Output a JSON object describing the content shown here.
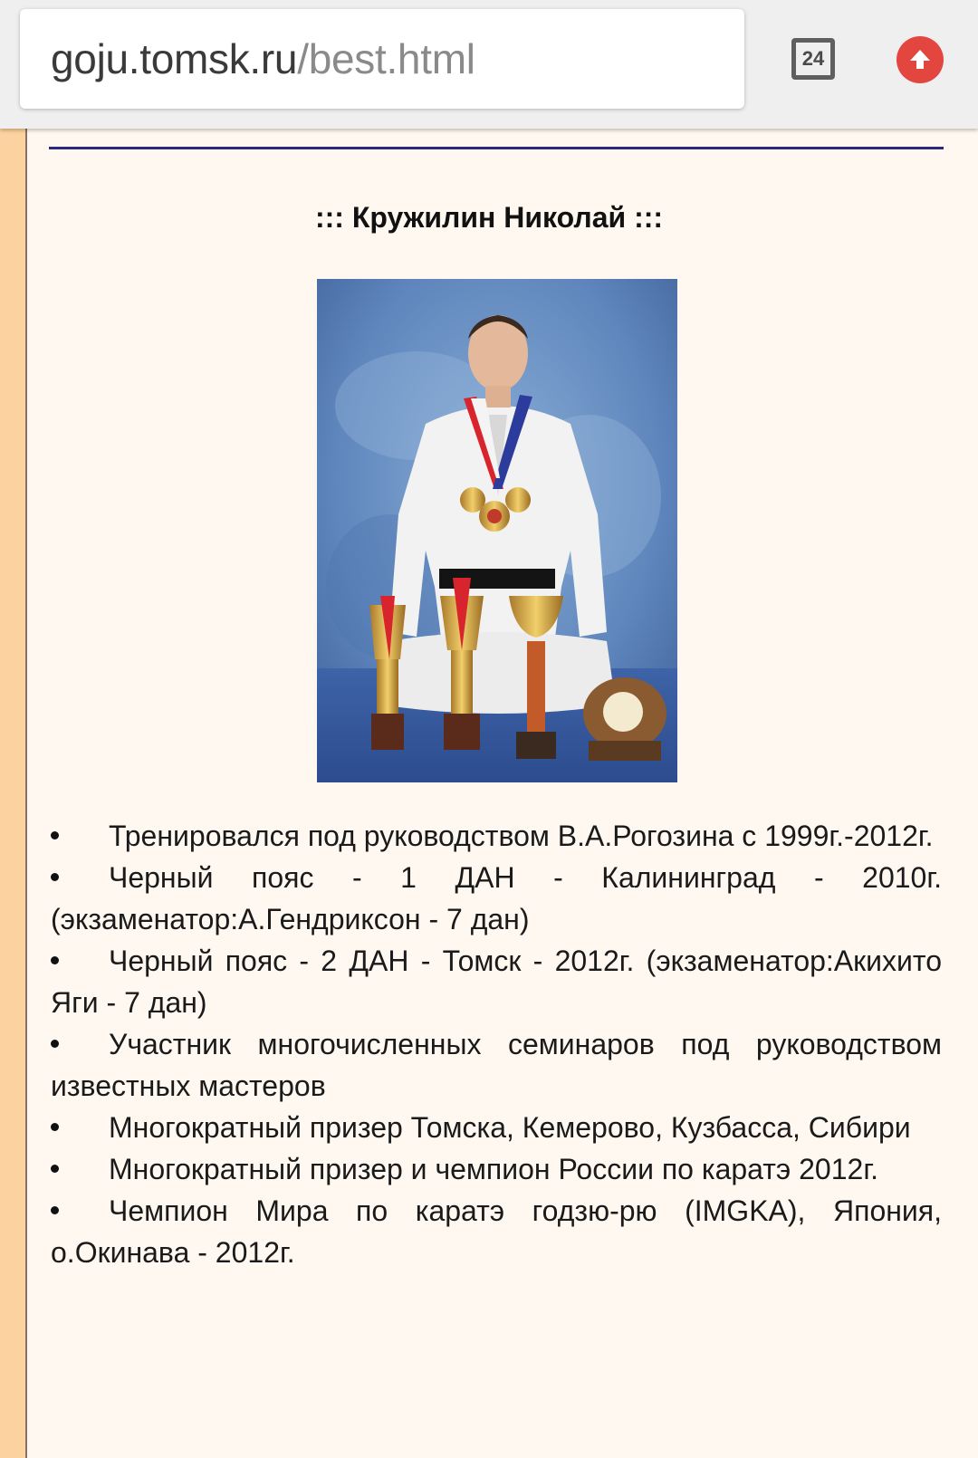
{
  "browser": {
    "url_host": "goju.tomsk.ru",
    "url_path": "/best.html",
    "tab_count": "24",
    "update_icon": "arrow-up-circle-icon",
    "tabs_icon": "tab-switcher-icon"
  },
  "colors": {
    "page_background": "#fcd2a0",
    "panel_background": "#fff8f0",
    "divider": "#2a2a80",
    "update_button": "#e3463f"
  },
  "content": {
    "name": "::: Кружилин Николай :::",
    "photo_alt": "photo-of-karateka-with-trophies",
    "achievements": [
      "Тренировался под руководством В.А.Рогозина с 1999г.-2012г.",
      "Черный пояс - 1 ДАН - Калининград - 2010г. (экзаменатор:А.Гендриксон - 7 дан)",
      "Черный пояс - 2 ДАН - Томск - 2012г. (экзаменатор:Акихито Яги - 7 дан)",
      "Участник многочисленных семинаров под руководством известных мастеров",
      "Многократный призер Томска, Кемерово, Кузбасса, Сибири",
      "Многократный призер и чемпион России по каратэ 2012г.",
      "Чемпион Мира по каратэ годзю-рю (IMGKA), Япония, о.Окинава - 2012г."
    ]
  }
}
